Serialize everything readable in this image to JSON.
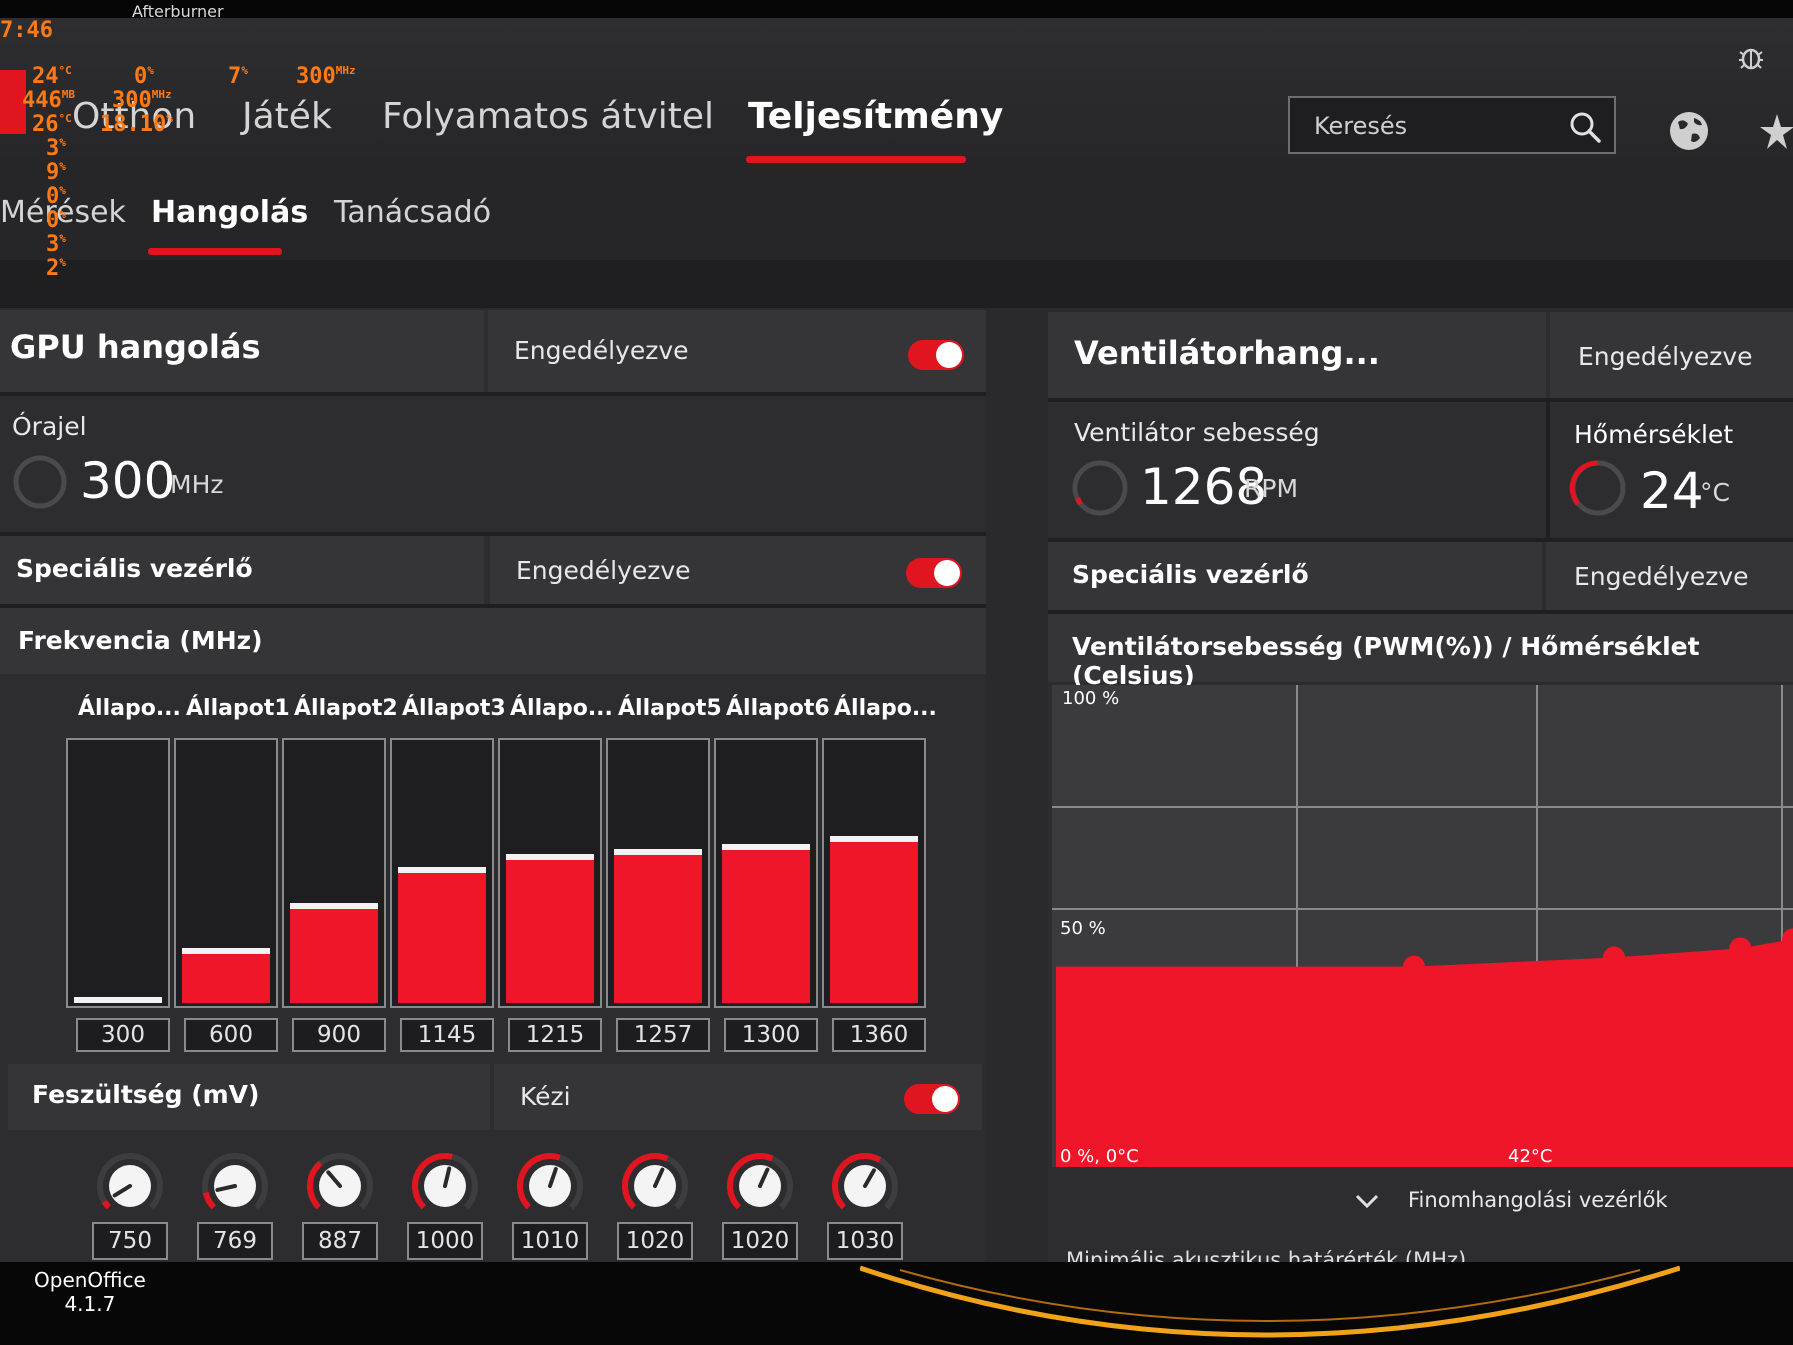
{
  "afterburner_title": "Afterburner",
  "clock": "7:46",
  "osd": {
    "row1": [
      {
        "value": "24",
        "unit": "°C"
      },
      {
        "value": "0",
        "unit": "%"
      },
      {
        "value": "7",
        "unit": "%"
      },
      {
        "value": "300",
        "unit": "MHz"
      }
    ],
    "row2": [
      {
        "value": "446",
        "unit": "MB"
      },
      {
        "value": "300",
        "unit": "MHz"
      }
    ],
    "row3": [
      {
        "value": "26",
        "unit": "°C"
      },
      {
        "value": "18.10",
        "unit": "%"
      }
    ],
    "column": [
      {
        "value": "3",
        "unit": "%"
      },
      {
        "value": "9",
        "unit": "%"
      },
      {
        "value": "0",
        "unit": "%"
      },
      {
        "value": "0",
        "unit": "%"
      },
      {
        "value": "3",
        "unit": "%"
      },
      {
        "value": "2",
        "unit": "%"
      }
    ]
  },
  "nav": {
    "items": [
      "Otthon",
      "Játék",
      "Folyamatos átvitel",
      "Teljesítmény"
    ],
    "active": "Teljesítmény",
    "search_placeholder": "Keresés"
  },
  "subnav": {
    "items": [
      "Mérések",
      "Hangolás",
      "Tanácsadó"
    ],
    "active": "Hangolás"
  },
  "gpu_panel": {
    "title": "GPU hangolás",
    "status": "Engedélyezve",
    "clock_label": "Órajel",
    "clock_value": "300",
    "clock_unit": "MHz",
    "advanced_label": "Speciális vezérlő",
    "advanced_status": "Engedélyezve",
    "freq_label": "Frekvencia (MHz)",
    "states": [
      {
        "label": "Állapo...",
        "value": "300",
        "level": 0.0
      },
      {
        "label": "Állapot1",
        "value": "600",
        "level": 0.19
      },
      {
        "label": "Állapot2",
        "value": "900",
        "level": 0.36
      },
      {
        "label": "Állapot3",
        "value": "1145",
        "level": 0.5
      },
      {
        "label": "Állapo...",
        "value": "1215",
        "level": 0.55
      },
      {
        "label": "Állapot5",
        "value": "1257",
        "level": 0.57
      },
      {
        "label": "Állapot6",
        "value": "1300",
        "level": 0.59
      },
      {
        "label": "Állapo...",
        "value": "1360",
        "level": 0.62
      }
    ],
    "voltage_label": "Feszültség (mV)",
    "voltage_mode": "Kézi",
    "voltages": [
      {
        "value": "750",
        "level": 0.05
      },
      {
        "value": "769",
        "level": 0.12
      },
      {
        "value": "887",
        "level": 0.35
      },
      {
        "value": "1000",
        "level": 0.55
      },
      {
        "value": "1010",
        "level": 0.57
      },
      {
        "value": "1020",
        "level": 0.59
      },
      {
        "value": "1020",
        "level": 0.59
      },
      {
        "value": "1030",
        "level": 0.61
      }
    ]
  },
  "fan_panel": {
    "title": "Ventilátorhang...",
    "status": "Engedélyezve",
    "speed_label": "Ventilátor sebesség",
    "speed_value": "1268",
    "speed_unit": "RPM",
    "temp_label": "Hőmérséklet",
    "temp_value": "24",
    "temp_unit": "°C",
    "advanced_label": "Speciális vezérlő",
    "advanced_status": "Engedélyezve",
    "chart_title": "Ventilátorsebesség (PWM(%)) / Hőmérséklet (Celsius)",
    "fine_tune": "Finomhangolási vezérlők",
    "cut_text": "Minimális akusztikus határérték (MHz)"
  },
  "chart_data": {
    "type": "area",
    "title": "Ventilátorsebesség (PWM(%)) / Hőmérséklet (Celsius)",
    "x_label_origin": "0 %, 0°C",
    "x_tick": "42°C",
    "y_ticks": [
      "100 %",
      "50 %"
    ],
    "ylim": [
      0,
      100
    ],
    "x": [
      0,
      34,
      53,
      65,
      70
    ],
    "values": [
      40,
      40,
      42,
      44,
      46
    ],
    "color": "#ee1628",
    "grid": true
  },
  "taskbar": {
    "app_name": "OpenOffice",
    "app_version": "4.1.7"
  },
  "colors": {
    "accent": "#e0151f",
    "osd": "#ff7a15"
  }
}
